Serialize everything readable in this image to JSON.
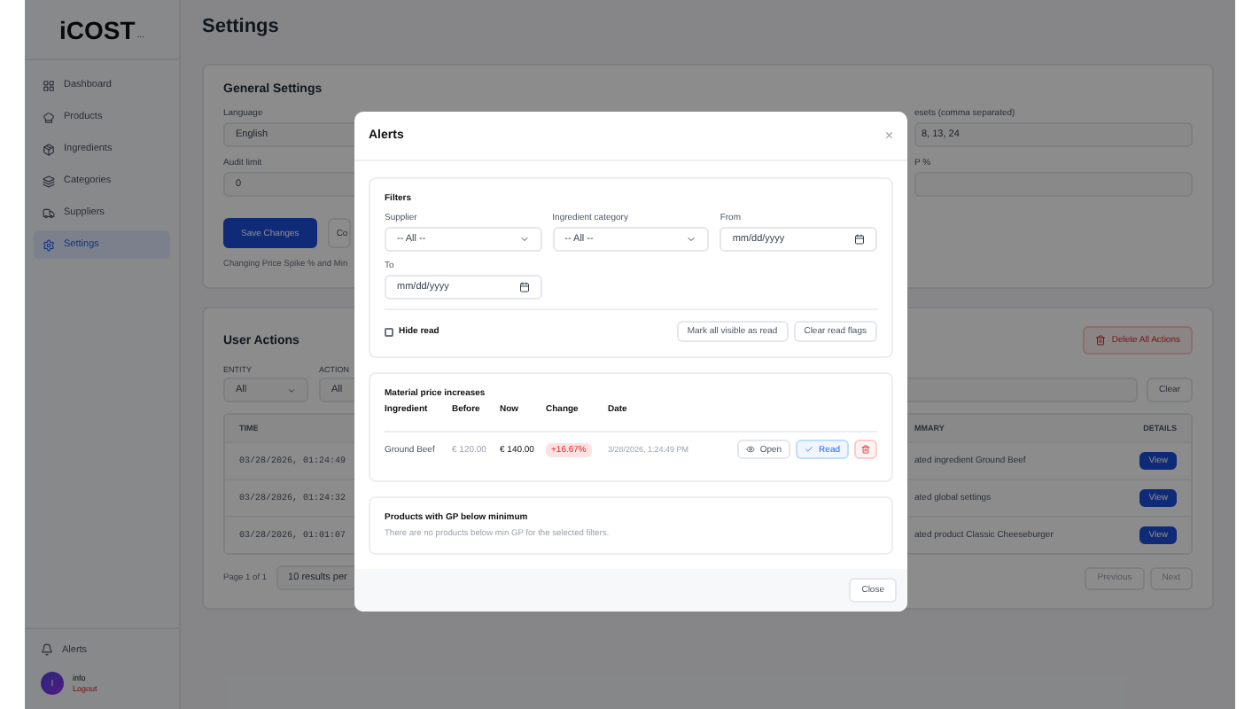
{
  "sidebar": {
    "logo": "iCOST",
    "logo_suffix": "...",
    "nav": [
      {
        "label": "Dashboard",
        "selected": false
      },
      {
        "label": "Products",
        "selected": false
      },
      {
        "label": "Ingredients",
        "selected": false
      },
      {
        "label": "Categories",
        "selected": false
      },
      {
        "label": "Suppliers",
        "selected": false
      },
      {
        "label": "Settings",
        "selected": true
      }
    ],
    "alerts": "Alerts",
    "user": {
      "initial": "I",
      "name": "info",
      "logout": "Logout"
    }
  },
  "page_title": "Settings",
  "general_settings": {
    "title": "General Settings",
    "fields_left": [
      {
        "label": "Language",
        "value": "English"
      },
      {
        "label": "Audit limit",
        "value": "0"
      }
    ],
    "fields_right": [
      {
        "label": "esets (comma separated)",
        "value": "8, 13, 24"
      },
      {
        "label": "P %"
      }
    ],
    "buttons": [
      "Save Changes",
      "Co"
    ],
    "note": "Changing Price Spike % and Min"
  },
  "user_actions": {
    "title": "User Actions",
    "delete_button": "Delete All Actions",
    "filters": [
      {
        "label": "ENTITY",
        "value": "All"
      },
      {
        "label": "ACTION",
        "value": "All"
      }
    ],
    "clear_button": "Clear",
    "columns": [
      "TIME",
      "MMARY",
      "DETAILS"
    ],
    "rows": [
      {
        "time": "03/28/2026, 01:24:49",
        "summary": "ated ingredient Ground Beef",
        "details": "View"
      },
      {
        "time": "03/28/2026, 01:24:32",
        "summary": "ated global settings",
        "details": "View"
      },
      {
        "time": "03/28/2026, 01:01:07",
        "summary": "ated product Classic Cheeseburger",
        "details": "View"
      }
    ],
    "pagination": {
      "page": "Page 1 of 1",
      "per_page": "10 results per",
      "previous": "Previous",
      "next": "Next"
    }
  },
  "alerts_modal": {
    "title": "Alerts",
    "close_icon": "×",
    "filters": {
      "title": "Filters",
      "fields": [
        {
          "label": "Supplier",
          "value": "-- All --",
          "kind": "select"
        },
        {
          "label": "Ingredient category",
          "value": "-- All --",
          "kind": "select"
        },
        {
          "label": "From",
          "value": "mm/dd/yyyy",
          "kind": "date"
        },
        {
          "label": "To",
          "value": "mm/dd/yyyy",
          "kind": "date"
        }
      ],
      "hide_read": {
        "label": "Hide read",
        "checked": false
      },
      "buttons": [
        "Mark all visible as read",
        "Clear read flags"
      ]
    },
    "price_increases": {
      "title": "Material price increases",
      "columns": [
        "Ingredient",
        "Before",
        "Now",
        "Change",
        "Date"
      ],
      "rows": [
        {
          "ingredient": "Ground Beef",
          "before": "€ 120.00",
          "now": "€ 140.00",
          "change": "+16.67%",
          "date": "3/28/2026, 1:24:49 PM",
          "open": "Open",
          "read": "Read"
        }
      ]
    },
    "low_gp": {
      "title": "Products with GP below minimum",
      "empty": "There are no products below min GP for the selected filters."
    },
    "close_button": "Close"
  }
}
